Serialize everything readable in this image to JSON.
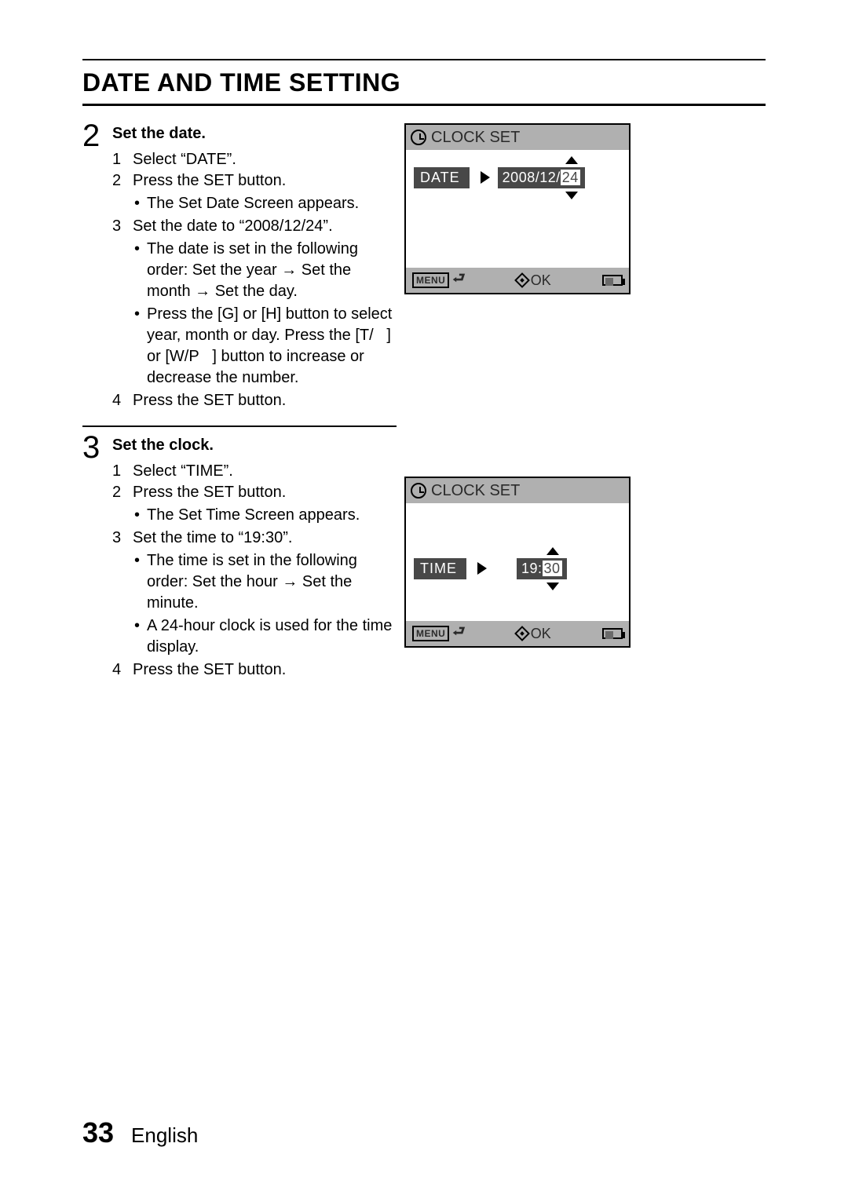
{
  "title": "DATE AND TIME SETTING",
  "steps": [
    {
      "num": "2",
      "heading": "Set the date.",
      "items": [
        {
          "n": "1",
          "t": "Select “DATE”."
        },
        {
          "n": "2",
          "t": "Press the SET button.",
          "bullets": [
            "The Set Date Screen appears."
          ]
        },
        {
          "n": "3",
          "t": "Set the date to “2008/12/24”.",
          "bullets": [
            "The date is set in the following order: Set the year → Set the month → Set the day.",
            "Press the [G] or [H] button to select year, month or day. Press the [T/   ] or [W/P   ] button to increase or decrease the number."
          ]
        },
        {
          "n": "4",
          "t": "Press the SET button."
        }
      ]
    },
    {
      "num": "3",
      "heading": "Set the clock.",
      "items": [
        {
          "n": "1",
          "t": "Select “TIME”."
        },
        {
          "n": "2",
          "t": "Press the SET button.",
          "bullets": [
            "The Set Time Screen appears."
          ]
        },
        {
          "n": "3",
          "t": "Set the time to “19:30”.",
          "bullets": [
            "The time is set in the following order: Set the hour → Set the minute.",
            "A 24-hour clock is used for the time display."
          ]
        },
        {
          "n": "4",
          "t": "Press the SET button."
        }
      ]
    }
  ],
  "lcd1": {
    "title": "CLOCK SET",
    "label": "DATE",
    "value_prefix": "2008/12/",
    "value_highlight": "24",
    "menu": "MENU",
    "ok": "OK"
  },
  "lcd2": {
    "title": "CLOCK SET",
    "label": "TIME",
    "value_prefix": "19:",
    "value_highlight": "30",
    "menu": "MENU",
    "ok": "OK"
  },
  "footer": {
    "page": "33",
    "lang": "English"
  }
}
